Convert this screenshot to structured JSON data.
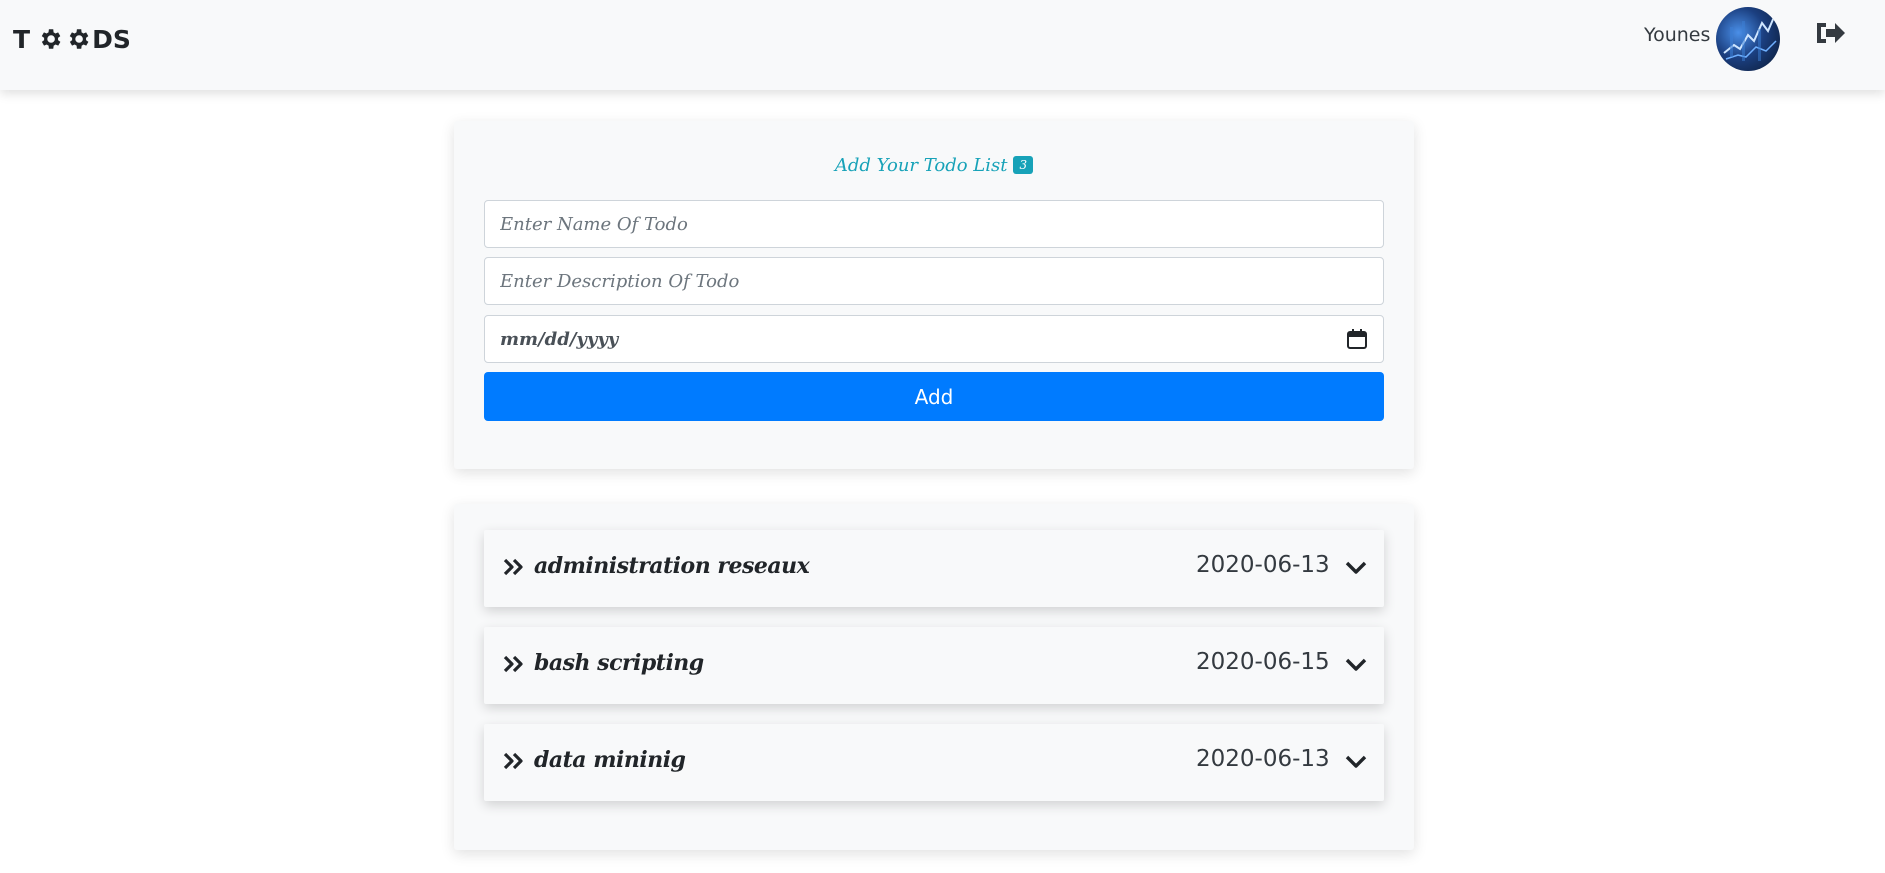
{
  "navbar": {
    "brand_prefix": "T",
    "brand_suffix": "DS",
    "user_name": "Younes"
  },
  "form": {
    "title": "Add Your Todo List",
    "badge_count": "3",
    "name_placeholder": "Enter Name Of Todo",
    "description_placeholder": "Enter Description Of Todo",
    "date_placeholder": "mm/dd/yyyy",
    "add_label": "Add"
  },
  "todos": [
    {
      "name": "administration reseaux",
      "date": "2020-06-13"
    },
    {
      "name": "bash scripting",
      "date": "2020-06-15"
    },
    {
      "name": "data mininig",
      "date": "2020-06-13"
    }
  ],
  "colors": {
    "accent": "#007bff",
    "info": "#17a2b8",
    "surface": "#f8f9fa"
  }
}
